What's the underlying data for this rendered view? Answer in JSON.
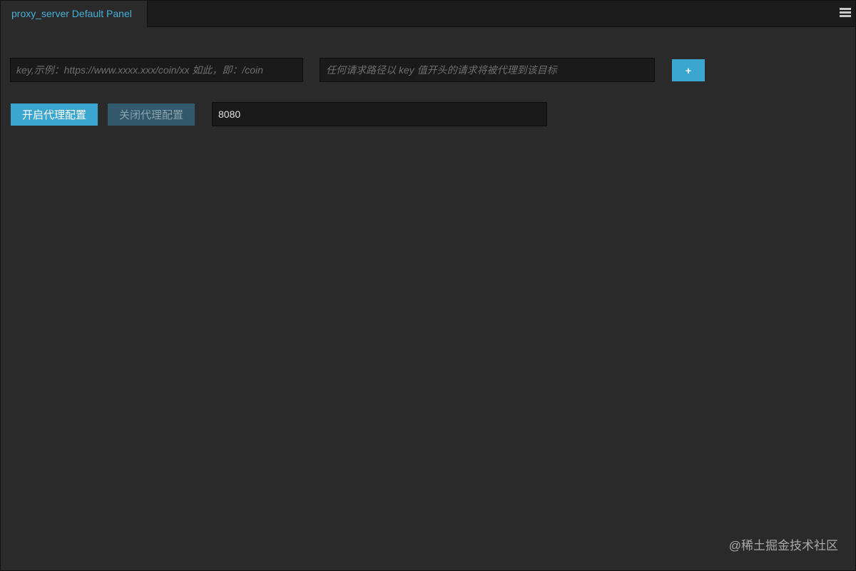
{
  "tab": {
    "title": "proxy_server Default Panel"
  },
  "menu": {
    "icon": "hamburger-menu-icon"
  },
  "form": {
    "key_placeholder": "key,示例：https://www.xxxx.xxx/coin/xx 如此，即：/coin",
    "target_placeholder": "任何请求路径以 key 值开头的请求将被代理到该目标",
    "add_label": "+",
    "enable_label": "开启代理配置",
    "disable_label": "关闭代理配置",
    "port_value": "8080"
  },
  "watermark": "@稀土掘金技术社区",
  "colors": {
    "accent": "#3ba6cf",
    "tab_title": "#46b0d8",
    "disabled": "#31596b",
    "background": "#2a2a2a"
  }
}
